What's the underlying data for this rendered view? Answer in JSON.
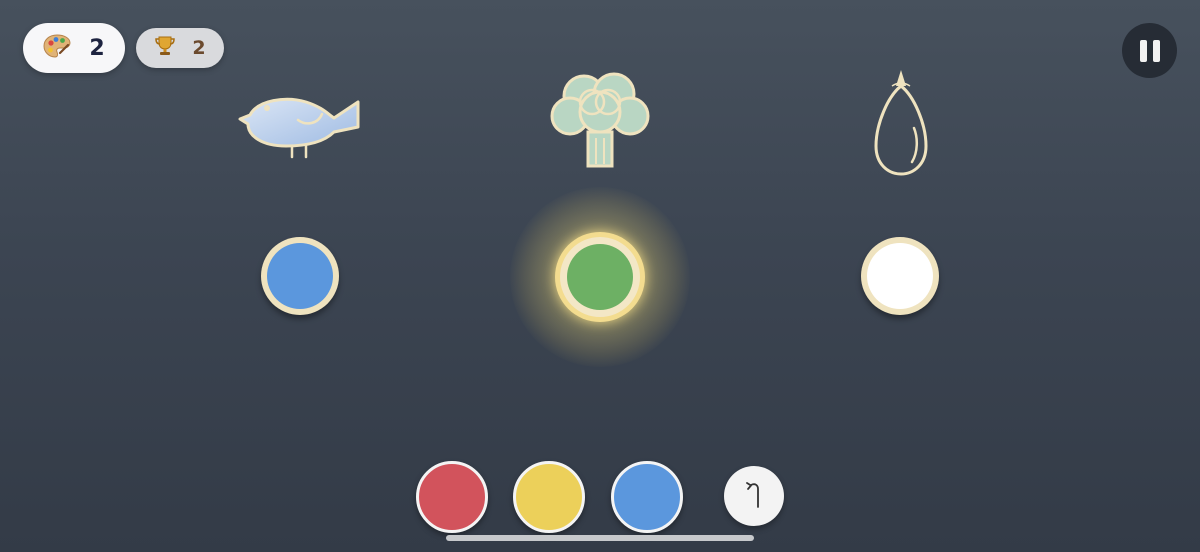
{
  "hud": {
    "palette_count": "2",
    "palette_icon": "palette-icon",
    "trophy_count": "2",
    "trophy_icon": "trophy-icon",
    "pause_icon": "pause-icon"
  },
  "items": [
    {
      "name": "bird",
      "icon": "bird-icon",
      "slot_color": "#5b97dd"
    },
    {
      "name": "broccoli",
      "icon": "broccoli-icon",
      "slot_color": "#6db064",
      "active": true
    },
    {
      "name": "drop",
      "icon": "drop-icon",
      "slot_color": "#ffffff"
    }
  ],
  "paints": [
    {
      "name": "red",
      "color": "#d2535c"
    },
    {
      "name": "yellow",
      "color": "#ecd05a"
    },
    {
      "name": "blue",
      "color": "#5b97dd"
    }
  ],
  "undo_icon": "undo-icon",
  "colors": {
    "background_top": "#47515d",
    "background_bottom": "#333b47",
    "slot_rim": "#efe3bf",
    "glow": "#ffe98c"
  }
}
